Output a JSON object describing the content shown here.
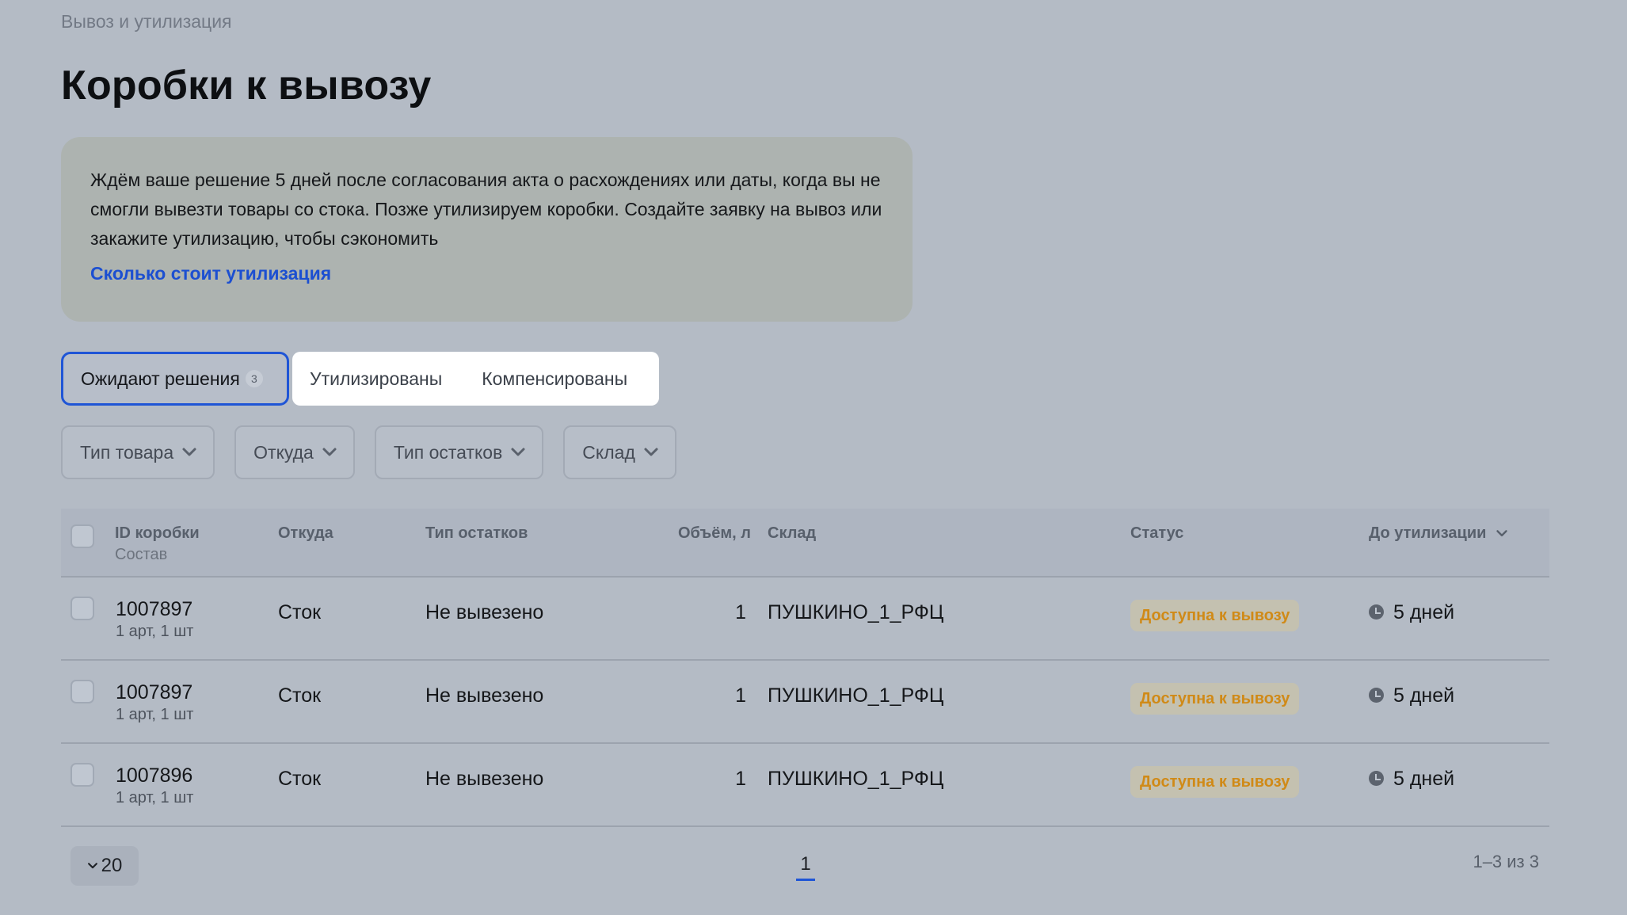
{
  "breadcrumb": "Вывоз и утилизация",
  "title": "Коробки к вывозу",
  "info": {
    "text": "Ждём ваше решение 5 дней после согласования акта о расхождениях или даты, когда вы не смогли вывезти товары со стока. Позже утилизируем коробки. Создайте заявку на вывоз или закажите утилизацию, чтобы сэкономить",
    "link": "Сколько стоит утилизация"
  },
  "tabs": {
    "active": {
      "label": "Ожидают решения",
      "count": "3"
    },
    "others": [
      "Утилизированы",
      "Компенсированы"
    ]
  },
  "filters": [
    "Тип товара",
    "Откуда",
    "Тип остатков",
    "Склад"
  ],
  "table": {
    "headers": {
      "id": "ID коробки",
      "id_sub": "Состав",
      "from": "Откуда",
      "type": "Тип остатков",
      "volume": "Объём, л",
      "warehouse": "Склад",
      "status": "Статус",
      "until": "До утилизации"
    },
    "rows": [
      {
        "id": "1007897",
        "composition": "1 арт, 1 шт",
        "from": "Сток",
        "type": "Не вывезено",
        "volume": "1",
        "warehouse": "ПУШКИНО_1_РФЦ",
        "status": "Доступна к вывозу",
        "until": "5 дней"
      },
      {
        "id": "1007897",
        "composition": "1 арт, 1 шт",
        "from": "Сток",
        "type": "Не вывезено",
        "volume": "1",
        "warehouse": "ПУШКИНО_1_РФЦ",
        "status": "Доступна к вывозу",
        "until": "5 дней"
      },
      {
        "id": "1007896",
        "composition": "1 арт, 1 шт",
        "from": "Сток",
        "type": "Не вывезено",
        "volume": "1",
        "warehouse": "ПУШКИНО_1_РФЦ",
        "status": "Доступна к вывозу",
        "until": "5 дней"
      }
    ]
  },
  "pagination": {
    "page_size": "20",
    "current_page": "1",
    "range": "1–3 из 3"
  },
  "colors": {
    "accent": "#1f55d6",
    "link": "#1c4fd1",
    "status": "#d08a17",
    "background": "#b4bbc5"
  }
}
